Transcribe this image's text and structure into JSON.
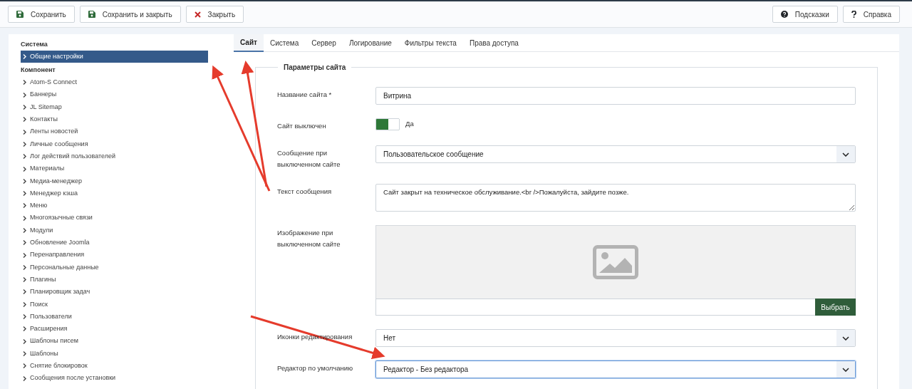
{
  "toolbar": {
    "left_buttons": [
      {
        "label": "Сохранить"
      },
      {
        "label": "Сохранить и закрыть"
      },
      {
        "label": "Закрыть"
      }
    ],
    "right_buttons": [
      {
        "label": "Подсказки"
      },
      {
        "label": "Справка"
      }
    ]
  },
  "sidebar": {
    "groups": [
      {
        "title": "Система",
        "items": [
          {
            "label": "Общие настройки",
            "selected": true
          }
        ]
      },
      {
        "title": "Компонент",
        "items": [
          {
            "label": "Atom-S Connect",
            "selected": false
          },
          {
            "label": "Баннеры",
            "selected": false
          },
          {
            "label": "JL Sitemap",
            "selected": false
          },
          {
            "label": "Контакты",
            "selected": false
          },
          {
            "label": "Ленты новостей",
            "selected": false
          },
          {
            "label": "Личные сообщения",
            "selected": false
          },
          {
            "label": "Лог действий пользователей",
            "selected": false
          },
          {
            "label": "Материалы",
            "selected": false
          },
          {
            "label": "Медиа-менеджер",
            "selected": false
          },
          {
            "label": "Менеджер кэша",
            "selected": false
          },
          {
            "label": "Меню",
            "selected": false
          },
          {
            "label": "Многоязычные связи",
            "selected": false
          },
          {
            "label": "Модули",
            "selected": false
          },
          {
            "label": "Обновление Joomla",
            "selected": false
          },
          {
            "label": "Перенаправления",
            "selected": false
          },
          {
            "label": "Персональные данные",
            "selected": false
          },
          {
            "label": "Плагины",
            "selected": false
          },
          {
            "label": "Планировщик задач",
            "selected": false
          },
          {
            "label": "Поиск",
            "selected": false
          },
          {
            "label": "Пользователи",
            "selected": false
          },
          {
            "label": "Расширения",
            "selected": false
          },
          {
            "label": "Шаблоны писем",
            "selected": false
          },
          {
            "label": "Шаблоны",
            "selected": false
          },
          {
            "label": "Снятие блокировок",
            "selected": false
          },
          {
            "label": "Сообщения после установки",
            "selected": false
          }
        ]
      }
    ]
  },
  "tabs": [
    {
      "label": "Сайт",
      "selected": true
    },
    {
      "label": "Система",
      "selected": false
    },
    {
      "label": "Сервер",
      "selected": false
    },
    {
      "label": "Логирование",
      "selected": false
    },
    {
      "label": "Фильтры текста",
      "selected": false
    },
    {
      "label": "Права доступа",
      "selected": false
    }
  ],
  "fieldset": {
    "legend": "Параметры сайта",
    "fields": [
      {
        "kind": "text",
        "label": "Название сайта *",
        "value": "Витрина"
      },
      {
        "kind": "toggle",
        "label": "Сайт выключен",
        "on": true,
        "value": "Да"
      },
      {
        "kind": "select",
        "label": "Сообщение при выключенном сайте",
        "value": "Пользовательское сообщение",
        "focused": false
      },
      {
        "kind": "textarea",
        "label": "Текст сообщения",
        "value": "Сайт закрыт на техническое обслуживание.<br />Пожалуйста, зайдите позже."
      },
      {
        "kind": "image",
        "label": "Изображение при выключенном сайте",
        "button": "Выбрать"
      },
      {
        "kind": "select",
        "label": "Иконки редактирования",
        "value": "Нет",
        "focused": false
      },
      {
        "kind": "select",
        "label": "Редактор по умолчанию",
        "value": "Редактор - Без редактора",
        "focused": true
      }
    ]
  }
}
